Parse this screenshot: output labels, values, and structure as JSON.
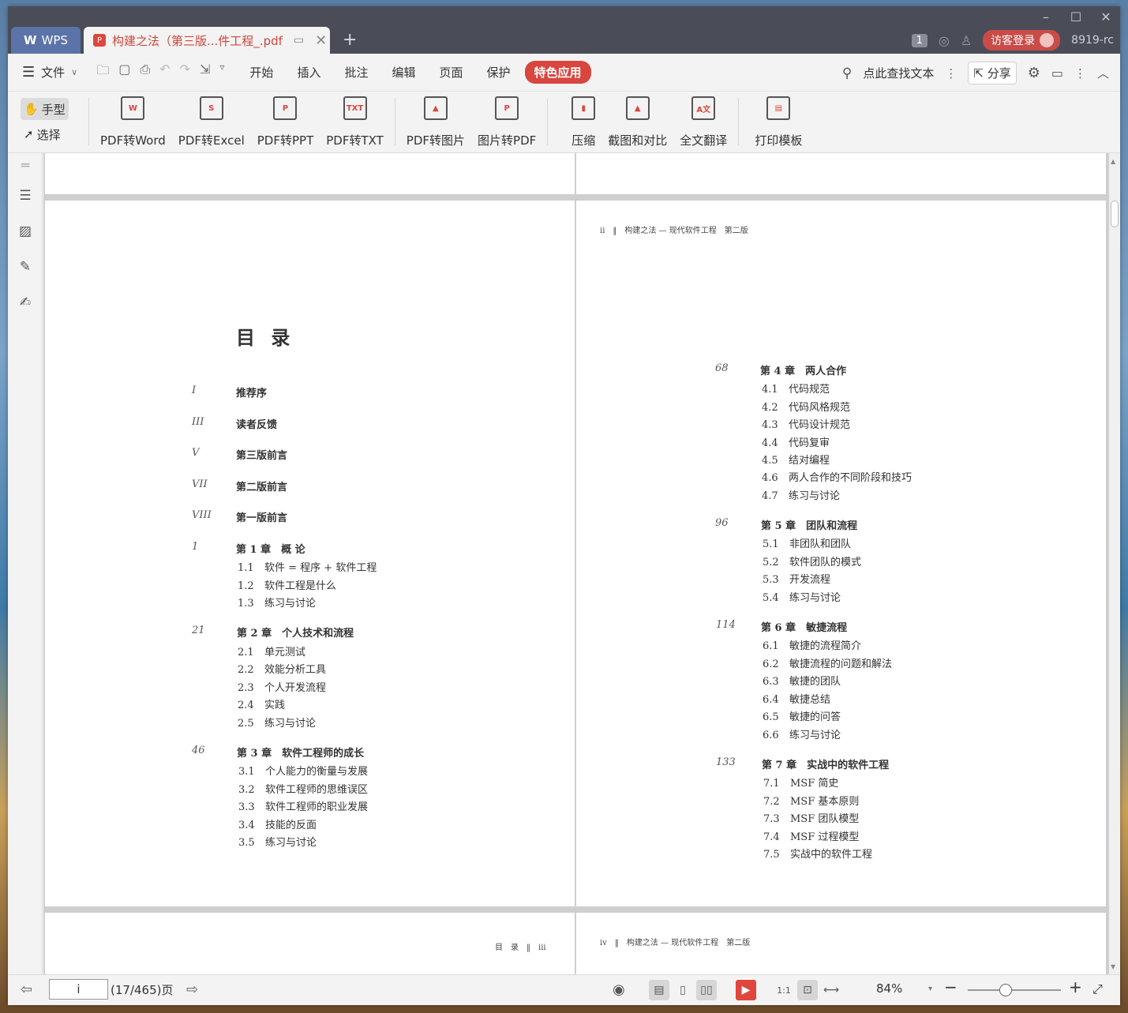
{
  "window": {
    "controls": [
      "–",
      "☐",
      "✕"
    ]
  },
  "tabs": {
    "app_label": "WPS",
    "doc_title": "构建之法（第三版...件工程_.pdf",
    "add_label": "+"
  },
  "titlebar_right": {
    "badge": "1",
    "login_label": "访客登录",
    "user_id": "8919-rc"
  },
  "menubar": {
    "file_label": "文件",
    "menus": [
      "开始",
      "插入",
      "批注",
      "编辑",
      "页面",
      "保护",
      "特色应用"
    ],
    "active_menu": "特色应用",
    "search_label": "点此查找文本",
    "share_label": "分享"
  },
  "ribbon": {
    "hand_label": "手型",
    "select_label": "选择",
    "items": [
      {
        "label": "PDF转Word",
        "icon": "pdf-to-word-icon",
        "glyph": "W"
      },
      {
        "label": "PDF转Excel",
        "icon": "pdf-to-excel-icon",
        "glyph": "S"
      },
      {
        "label": "PDF转PPT",
        "icon": "pdf-to-ppt-icon",
        "glyph": "P"
      },
      {
        "label": "PDF转TXT",
        "icon": "pdf-to-txt-icon",
        "glyph": "TXT"
      },
      {
        "label": "PDF转图片",
        "icon": "pdf-to-image-icon",
        "glyph": "▲"
      },
      {
        "label": "图片转PDF",
        "icon": "image-to-pdf-icon",
        "glyph": "P"
      },
      {
        "label": "压缩",
        "icon": "compress-icon",
        "glyph": "▮"
      },
      {
        "label": "截图和对比",
        "icon": "screenshot-compare-icon",
        "glyph": "▲"
      },
      {
        "label": "全文翻译",
        "icon": "translate-icon",
        "glyph": "A文"
      },
      {
        "label": "打印模板",
        "icon": "print-template-icon",
        "glyph": "▤"
      }
    ]
  },
  "page_left": {
    "title": "目 录",
    "front": [
      {
        "num": "I",
        "text": "推荐序"
      },
      {
        "num": "III",
        "text": "读者反馈"
      },
      {
        "num": "V",
        "text": "第三版前言"
      },
      {
        "num": "VII",
        "text": "第二版前言"
      },
      {
        "num": "VIII",
        "text": "第一版前言"
      }
    ],
    "chapters": [
      {
        "num": "1",
        "title": "第 1 章　概 论",
        "sections": [
          [
            "1.1",
            "软件 = 程序 + 软件工程"
          ],
          [
            "1.2",
            "软件工程是什么"
          ],
          [
            "1.3",
            "练习与讨论"
          ]
        ]
      },
      {
        "num": "21",
        "title": "第 2 章　个人技术和流程",
        "sections": [
          [
            "2.1",
            "单元测试"
          ],
          [
            "2.2",
            "效能分析工具"
          ],
          [
            "2.3",
            "个人开发流程"
          ],
          [
            "2.4",
            "实践"
          ],
          [
            "2.5",
            "练习与讨论"
          ]
        ]
      },
      {
        "num": "46",
        "title": "第 3 章　软件工程师的成长",
        "sections": [
          [
            "3.1",
            "个人能力的衡量与发展"
          ],
          [
            "3.2",
            "软件工程师的思维误区"
          ],
          [
            "3.3",
            "软件工程师的职业发展"
          ],
          [
            "3.4",
            "技能的反面"
          ],
          [
            "3.5",
            "练习与讨论"
          ]
        ]
      }
    ]
  },
  "page_right": {
    "running_head": "ii　‖　构建之法 — 现代软件工程　第二版",
    "chapters": [
      {
        "num": "68",
        "title": "第 4 章　两人合作",
        "sections": [
          [
            "4.1",
            "代码规范"
          ],
          [
            "4.2",
            "代码风格规范"
          ],
          [
            "4.3",
            "代码设计规范"
          ],
          [
            "4.4",
            "代码复审"
          ],
          [
            "4.5",
            "结对编程"
          ],
          [
            "4.6",
            "两人合作的不同阶段和技巧"
          ],
          [
            "4.7",
            "练习与讨论"
          ]
        ]
      },
      {
        "num": "96",
        "title": "第 5 章　团队和流程",
        "sections": [
          [
            "5.1",
            "非团队和团队"
          ],
          [
            "5.2",
            "软件团队的模式"
          ],
          [
            "5.3",
            "开发流程"
          ],
          [
            "5.4",
            "练习与讨论"
          ]
        ]
      },
      {
        "num": "114",
        "title": "第 6 章　敏捷流程",
        "sections": [
          [
            "6.1",
            "敏捷的流程简介"
          ],
          [
            "6.2",
            "敏捷流程的问题和解法"
          ],
          [
            "6.3",
            "敏捷的团队"
          ],
          [
            "6.4",
            "敏捷总结"
          ],
          [
            "6.5",
            "敏捷的问答"
          ],
          [
            "6.6",
            "练习与讨论"
          ]
        ]
      },
      {
        "num": "133",
        "title": "第 7 章　实战中的软件工程",
        "sections": [
          [
            "7.1",
            "MSF 简史"
          ],
          [
            "7.2",
            "MSF 基本原则"
          ],
          [
            "7.3",
            "MSF 团队模型"
          ],
          [
            "7.4",
            "MSF 过程模型"
          ],
          [
            "7.5",
            "实战中的软件工程"
          ]
        ]
      }
    ]
  },
  "page_bottom_left": {
    "running_head": "目　录　‖　iii"
  },
  "page_bottom_right": {
    "running_head": "iv　‖　构建之法 — 现代软件工程　第二版"
  },
  "statusbar": {
    "page_value": "i",
    "page_count": "(17/465)页",
    "zoom": "84%"
  }
}
